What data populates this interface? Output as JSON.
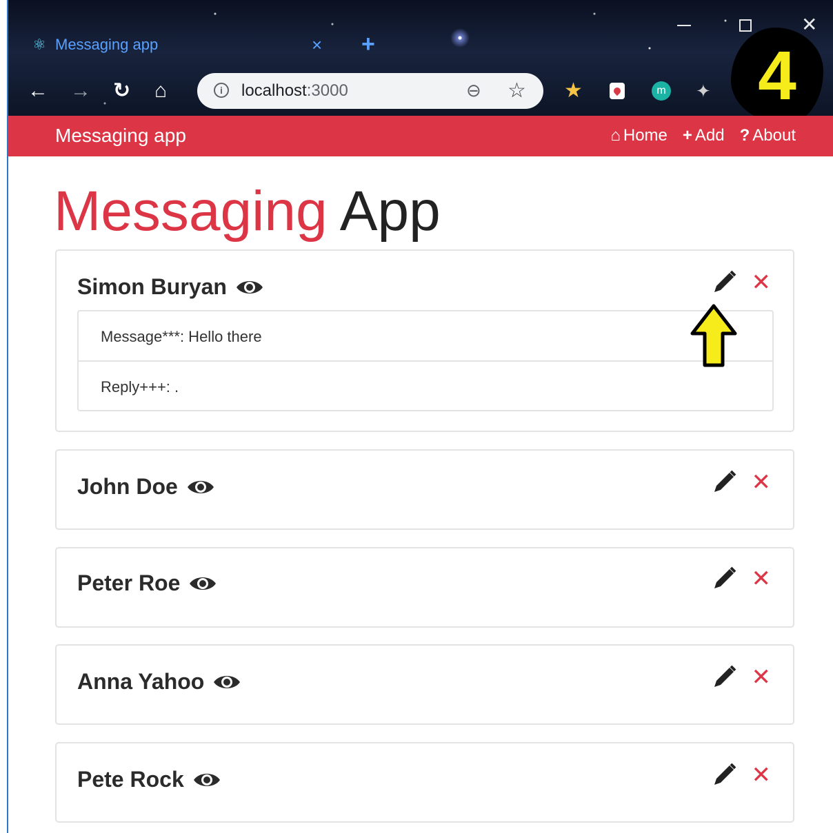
{
  "browser": {
    "tab_title": "Messaging app",
    "tab_close": "×",
    "new_tab": "+",
    "url_host": "localhost",
    "url_port": ":3000",
    "step_badge": "4"
  },
  "navbar": {
    "brand": "Messaging app",
    "links": [
      {
        "label": "Home",
        "icon": "home-icon"
      },
      {
        "label": "Add",
        "icon": "plus-icon"
      },
      {
        "label": "About",
        "icon": "question-icon"
      }
    ]
  },
  "page": {
    "title_accent": "Messaging",
    "title_rest": " App"
  },
  "contacts": [
    {
      "name": "Simon Buryan",
      "expanded": true,
      "message": "Message***: Hello there",
      "reply": "Reply+++: ."
    },
    {
      "name": "John Doe",
      "expanded": false
    },
    {
      "name": "Peter Roe",
      "expanded": false
    },
    {
      "name": "Anna Yahoo",
      "expanded": false
    },
    {
      "name": "Pete Rock",
      "expanded": false
    }
  ],
  "colors": {
    "accent": "#dc3545",
    "callout": "#f6ec1c"
  }
}
